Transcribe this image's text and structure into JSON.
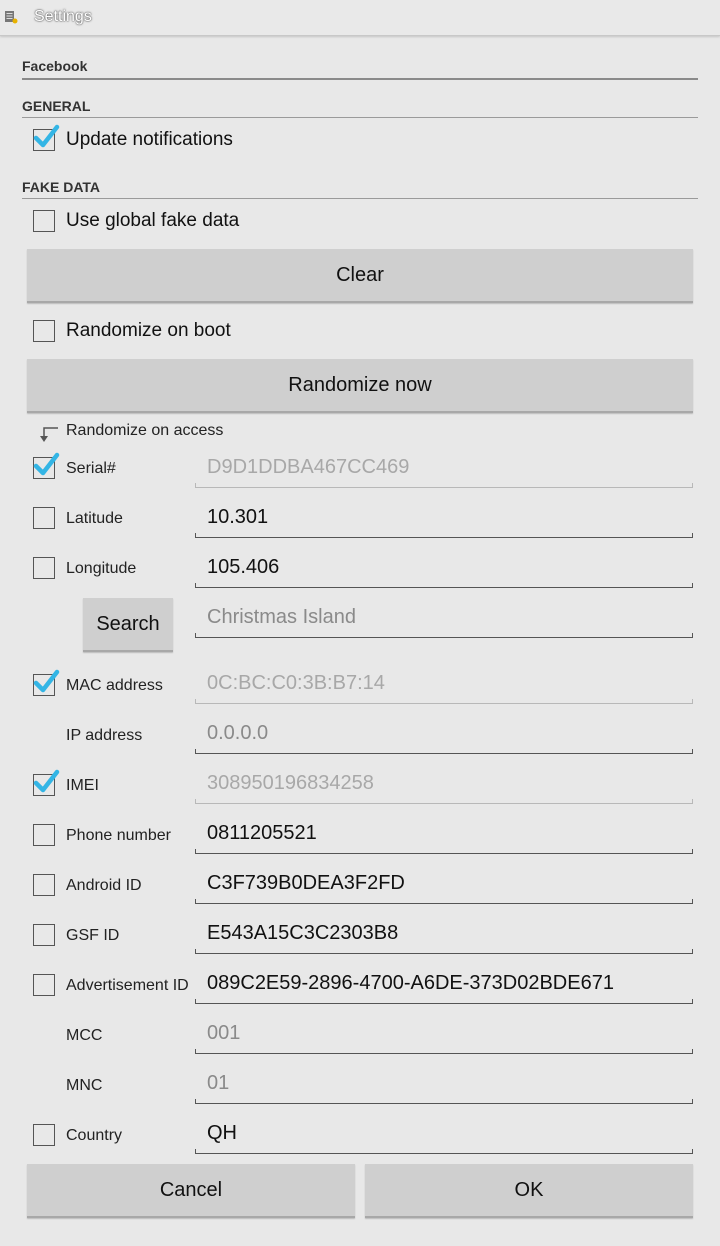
{
  "window": {
    "title": "Settings",
    "icon": "settings-app-icon"
  },
  "sections": {
    "facebook": "Facebook",
    "general": "GENERAL",
    "fake_data": "FAKE DATA"
  },
  "general": {
    "update_notifications": {
      "label": "Update notifications",
      "checked": true
    }
  },
  "fake": {
    "use_global": {
      "label": "Use global fake data",
      "checked": false
    },
    "clear_label": "Clear",
    "randomize_on_boot": {
      "label": "Randomize on boot",
      "checked": false
    },
    "randomize_now_label": "Randomize now",
    "randomize_on_access_label": "Randomize on access",
    "search_label": "Search",
    "fields": {
      "serial": {
        "label": "Serial#",
        "value": "D9D1DDBA467CC469",
        "checked": true
      },
      "latitude": {
        "label": "Latitude",
        "value": "10.301",
        "checked": false
      },
      "longitude": {
        "label": "Longitude",
        "value": "105.406",
        "checked": false
      },
      "location_search": {
        "placeholder": "Christmas Island"
      },
      "mac": {
        "label": "MAC address",
        "value": "0C:BC:C0:3B:B7:14",
        "checked": true
      },
      "ip": {
        "label": "IP address",
        "value": "0.0.0.0"
      },
      "imei": {
        "label": "IMEI",
        "value": "308950196834258",
        "checked": true
      },
      "phone": {
        "label": "Phone number",
        "value": "0811205521",
        "checked": false
      },
      "android_id": {
        "label": "Android ID",
        "value": "C3F739B0DEA3F2FD",
        "checked": false
      },
      "gsf_id": {
        "label": "GSF ID",
        "value": "E543A15C3C2303B8",
        "checked": false
      },
      "ad_id": {
        "label": "Advertisement ID",
        "value": "089C2E59-2896-4700-A6DE-373D02BDE671",
        "checked": false
      },
      "mcc": {
        "label": "MCC",
        "value": "001"
      },
      "mnc": {
        "label": "MNC",
        "value": "01"
      },
      "country": {
        "label": "Country",
        "value": "QH",
        "checked": false
      }
    }
  },
  "footer": {
    "cancel_label": "Cancel",
    "ok_label": "OK"
  },
  "colors": {
    "accent": "#33b5e5",
    "background": "#e8e8e8",
    "button": "#cfcfcf"
  }
}
